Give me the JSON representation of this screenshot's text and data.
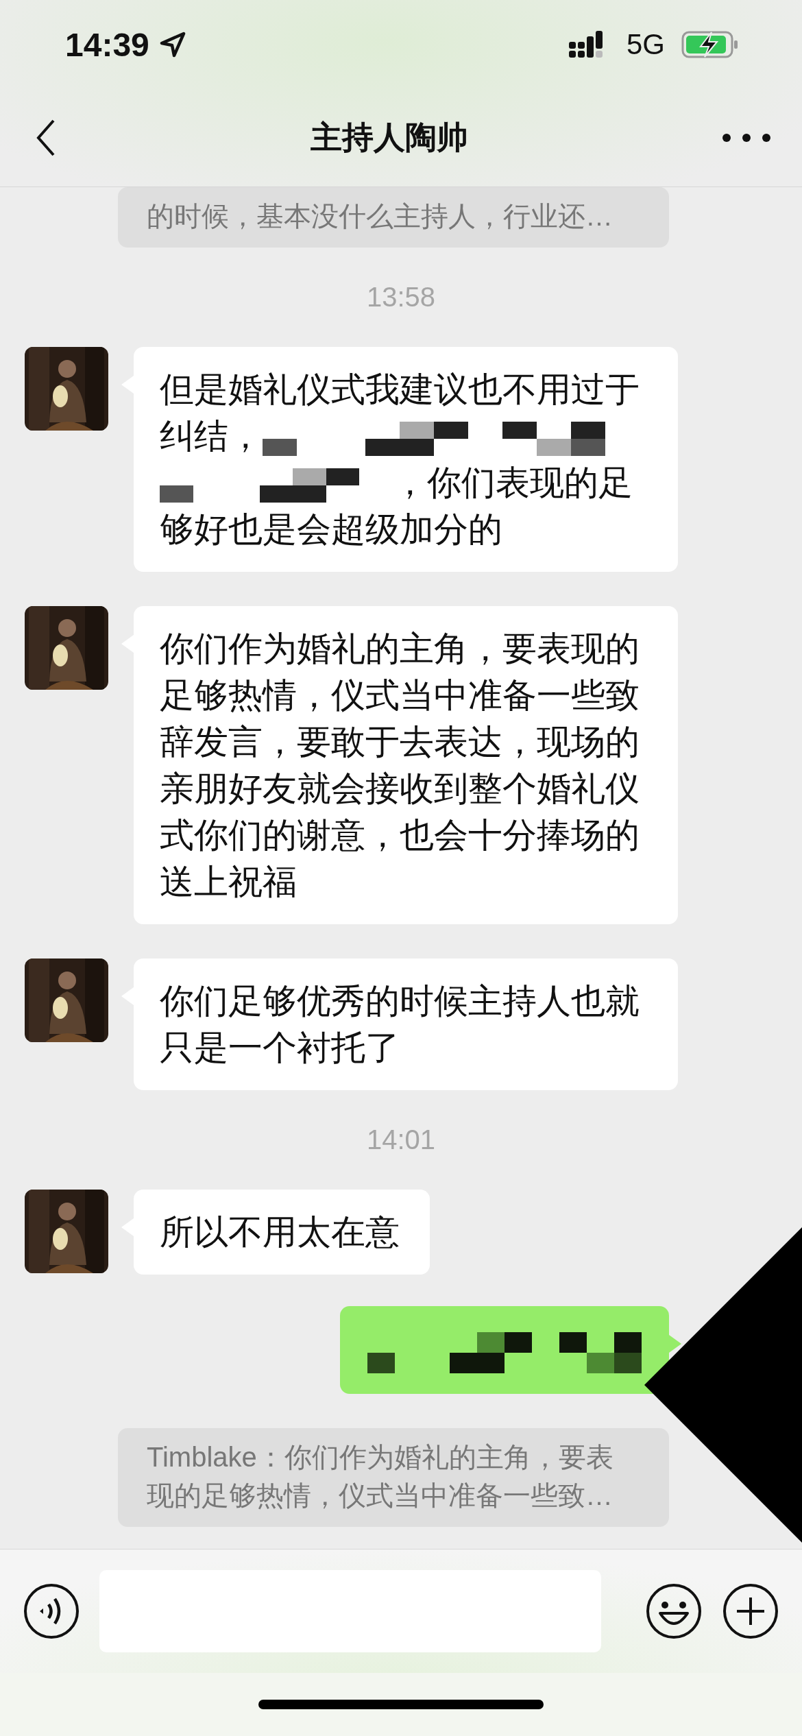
{
  "status_bar": {
    "time": "14:39",
    "network": "5G"
  },
  "header": {
    "title": "主持人陶帅"
  },
  "messages": [
    {
      "kind": "quote",
      "text": "的时候，基本没什么主持人，行业还…"
    },
    {
      "kind": "time",
      "text": "13:58"
    },
    {
      "kind": "received",
      "parts": [
        {
          "kind": "text",
          "text": "但是婚礼仪式我建议也不用过于"
        },
        {
          "kind": "text",
          "text": "纠结，"
        },
        {
          "kind": "redacted"
        },
        {
          "kind": "redacted"
        },
        {
          "kind": "text",
          "text": "，你们表现的足"
        },
        {
          "kind": "text",
          "text": "够好也是会超级加分的"
        }
      ]
    },
    {
      "kind": "received",
      "parts": [
        {
          "kind": "text",
          "text": "你们作为婚礼的主角，要表现的足够热情，仪式当中准备一些致辞发言，要敢于去表达，现场的亲朋好友就会接收到整个婚礼仪式你们的谢意，也会十分捧场的送上祝福"
        }
      ]
    },
    {
      "kind": "received",
      "parts": [
        {
          "kind": "text",
          "text": "你们足够优秀的时候主持人也就只是一个衬托了"
        }
      ]
    },
    {
      "kind": "time",
      "text": "14:01"
    },
    {
      "kind": "received",
      "parts": [
        {
          "kind": "text",
          "text": "所以不用太在意"
        }
      ]
    },
    {
      "kind": "sent",
      "parts": [
        {
          "kind": "redacted"
        }
      ]
    },
    {
      "kind": "quote",
      "text": "Timblake：你们作为婚礼的主角，要表现的足够热情，仪式当中准备一些致…"
    }
  ]
}
